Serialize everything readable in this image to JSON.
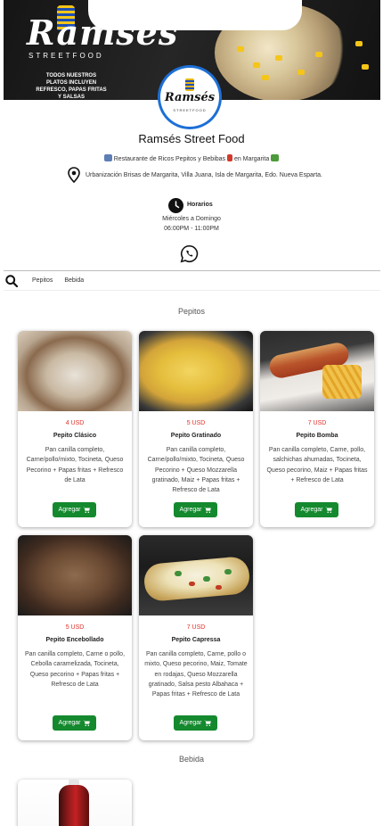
{
  "banner": {
    "brand": "Ramsés",
    "brand_sub": "STREETFOOD",
    "promo": "TODOS NUESTROS PLATOS INCLUYEN REFRESCO, PAPAS FRITAS Y SALSAS"
  },
  "avatar": {
    "brand": "Ramsés",
    "brand_sub": "STREETFOOD"
  },
  "store": {
    "name": "Ramsés Street Food",
    "tagline_prefix": "Restaurante de Ricos Pepitos y Bebibas",
    "tagline_suffix": "en Margarita",
    "address": "Urbanización Brisas de Margarita, Villa Juana, Isla de Margarita, Edo. Nueva Esparta."
  },
  "hours": {
    "title": "Horarios",
    "days": "Miércoles a Domingo",
    "time": "06:00PM - 11:00PM"
  },
  "nav": {
    "items": [
      "Pepitos",
      "Bebida"
    ]
  },
  "sections": [
    {
      "title": "Pepitos",
      "products": [
        {
          "price": "4 USD",
          "name": "Pepito Clásico",
          "desc": "Pan canilla completo, Carne/pollo/mixto, Tocineta, Queso Pecorino + Papas fritas + Refresco de Lata",
          "button": "Agregar"
        },
        {
          "price": "5 USD",
          "name": "Pepito Gratinado",
          "desc": "Pan canilla completo, Carne/pollo/mixto, Tocineta, Queso Pecorino + Queso Mozzarella gratinado, Maiz + Papas fritas + Refresco de Lata",
          "button": "Agregar"
        },
        {
          "price": "7 USD",
          "name": "Pepito Bomba",
          "desc": "Pan canilla completo, Carne, pollo, salchichas ahumadas, Tocineta, Queso pecorino, Maiz + Papas fritas + Refresco de Lata",
          "button": "Agregar"
        },
        {
          "price": "5 USD",
          "name": "Pepito Encebollado",
          "desc": "Pan canilla completo, Carne o pollo, Cebolla caramelizada, Tocineta, Queso pecorino + Papas fritas + Refresco de Lata",
          "button": "Agregar"
        },
        {
          "price": "7 USD",
          "name": "Pepito Capressa",
          "desc": "Pan canilla completo, Carne, pollo o mixto, Queso pecorino, Maiz, Tomate en rodajas, Queso Mozzarella gratinado, Salsa pesto Albahaca + Papas fritas + Refresco de Lata",
          "button": "Agregar"
        }
      ]
    },
    {
      "title": "Bebida",
      "products": []
    }
  ],
  "colors": {
    "price": "#e0312a",
    "button": "#14892e",
    "avatar_ring": "#1d6fd6"
  },
  "icons": [
    "location-pin-icon",
    "clock-icon",
    "whatsapp-icon",
    "search-icon",
    "cart-icon"
  ]
}
